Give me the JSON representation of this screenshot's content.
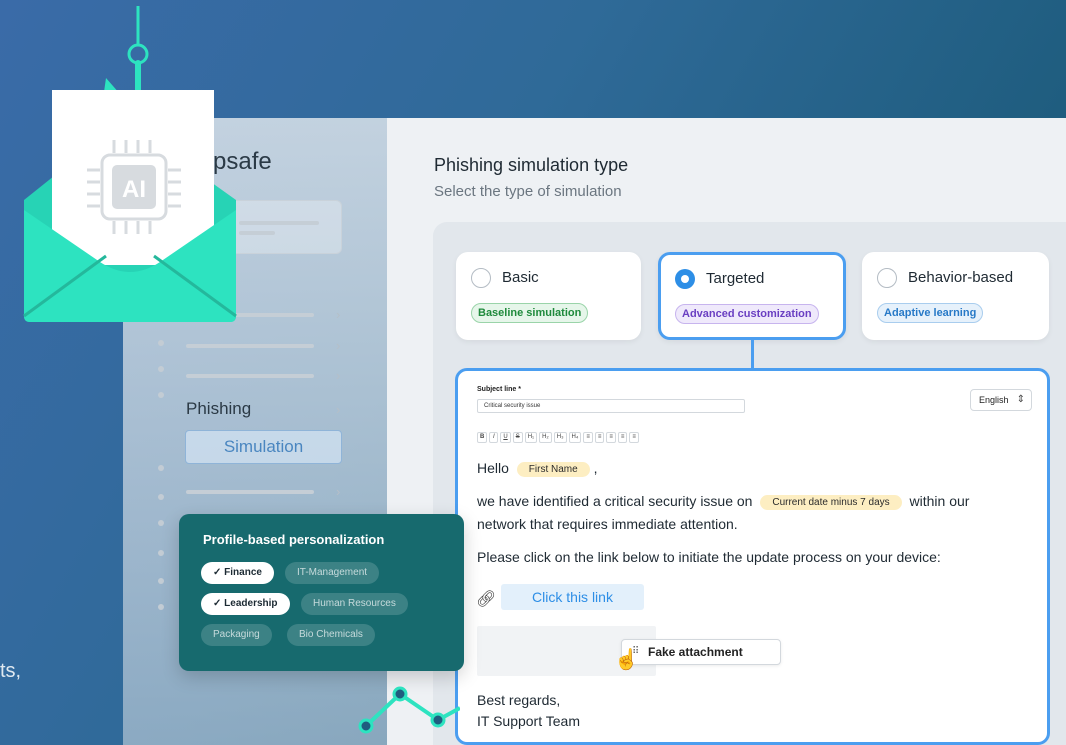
{
  "sidebar": {
    "brand": "psafe",
    "phishing": "Phishing",
    "simulation": "Simulation"
  },
  "header": {
    "title": "Phishing simulation type",
    "subtitle": "Select the type of simulation"
  },
  "types": [
    {
      "label": "Basic",
      "pill": "Baseline simulation",
      "selected": false
    },
    {
      "label": "Targeted",
      "pill": "Advanced customization",
      "selected": true
    },
    {
      "label": "Behavior-based",
      "pill": "Adaptive learning",
      "selected": false
    }
  ],
  "editor": {
    "subject_label": "Subject line *",
    "subject_value": "Critical security issue",
    "language": "English",
    "toolbar": [
      "B",
      "I",
      "U",
      "S",
      "H₁",
      "H₂",
      "H₃",
      "H₄",
      "≡",
      "≡",
      "≡",
      "≡",
      "≡"
    ],
    "hello": "Hello",
    "first_name_token": "First Name",
    "comma": ",",
    "body1_pre": "we have identified a critical security issue on",
    "date_token": "Current date minus 7 days",
    "body1_post": "within our",
    "body1_line2": "network that requires immediate attention.",
    "body2": "Please click on the link below to initiate the update process on your device:",
    "link_label": "Click this link",
    "attachment": "Fake attachment",
    "sign1": "Best regards,",
    "sign2": "IT Support Team"
  },
  "personalization": {
    "title": "Profile-based personalization",
    "tags": [
      {
        "label": "Finance",
        "on": true
      },
      {
        "label": "IT-Management",
        "on": false
      },
      {
        "label": "Leadership",
        "on": true
      },
      {
        "label": "Human Resources",
        "on": false
      },
      {
        "label": "Packaging",
        "on": false
      },
      {
        "label": "Bio Chemicals",
        "on": false
      }
    ]
  },
  "illustration": {
    "chip_text": "AI"
  },
  "fragment": "ts,",
  "colors": {
    "accent": "#4b9ef0",
    "envelope": "#2de3c0",
    "persona_bg": "#176a6e"
  }
}
